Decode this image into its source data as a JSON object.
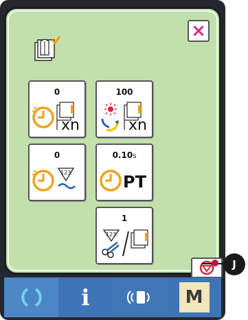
{
  "window": {
    "close_label": "×"
  },
  "tiles": [
    {
      "name": "count-times-n-tile",
      "value": "0",
      "unit": ""
    },
    {
      "name": "count-reset-times-n-tile",
      "value": "100",
      "unit": ""
    },
    {
      "name": "thread-counter-tile",
      "value": "0",
      "unit": ""
    },
    {
      "name": "pause-time-tile",
      "value": "0.10",
      "unit": "s"
    },
    {
      "name": "thread-cut-counter-tile",
      "value": "1",
      "unit": ""
    }
  ],
  "labels": {
    "xn": "xn",
    "pt": "PT",
    "counter_123": "123."
  },
  "callout": {
    "letter": "J"
  },
  "taskbar": {
    "items": [
      "ready-icon",
      "info-icon",
      "communication-icon",
      "mode-icon"
    ],
    "info_label": "i",
    "mode_label": "M"
  },
  "colors": {
    "screen_bg": "#c2e0ab",
    "close_accent": "#d1317f",
    "stop_red": "#e0203a",
    "taskbar_ready": "#4c86c6",
    "taskbar_info": "#3f74b6",
    "taskbar_comm": "#4177b7",
    "taskbar_mode": "#f2e6bc"
  }
}
